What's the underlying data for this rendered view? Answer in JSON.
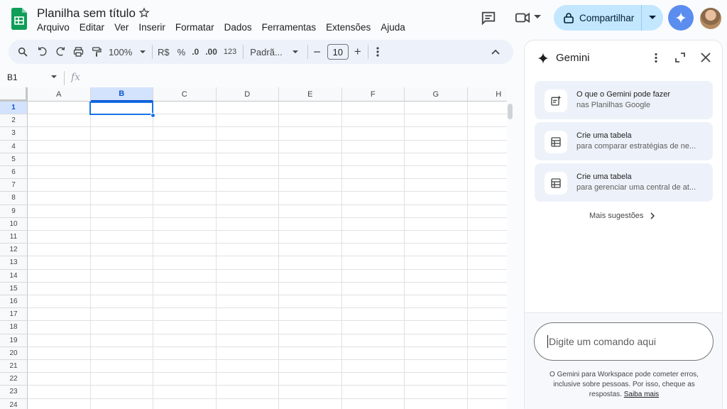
{
  "doc": {
    "title": "Planilha sem título"
  },
  "menu": [
    "Arquivo",
    "Editar",
    "Ver",
    "Inserir",
    "Formatar",
    "Dados",
    "Ferramentas",
    "Extensões",
    "Ajuda"
  ],
  "header": {
    "share_label": "Compartilhar"
  },
  "toolbar": {
    "zoom": "100%",
    "currency": "R$",
    "percent": "%",
    "dec_dec": ".0",
    "dec_inc": ".00",
    "number_format": "123",
    "font": "Padrã...",
    "font_size": "10"
  },
  "namebox": {
    "cell": "B1",
    "fx": "fx"
  },
  "grid": {
    "columns": [
      "A",
      "B",
      "C",
      "D",
      "E",
      "F",
      "G",
      "H"
    ],
    "rows": [
      "1",
      "2",
      "3",
      "4",
      "5",
      "6",
      "7",
      "8",
      "9",
      "10",
      "11",
      "12",
      "13",
      "14",
      "15",
      "16",
      "17",
      "18",
      "19",
      "20",
      "21",
      "22",
      "23",
      "24"
    ],
    "selected_column": "B",
    "selected_row": "1"
  },
  "gemini": {
    "title": "Gemini",
    "suggestions": [
      {
        "title": "O que o Gemini pode fazer",
        "subtitle": "nas Planilhas Google",
        "icon": "sparkle-doc-icon"
      },
      {
        "title": "Crie uma tabela",
        "subtitle": "para comparar estratégias de ne...",
        "icon": "table-icon"
      },
      {
        "title": "Crie uma tabela",
        "subtitle": "para gerenciar uma central de at...",
        "icon": "table-icon"
      }
    ],
    "more_label": "Mais sugestões",
    "prompt_placeholder": "Digite um comando aqui",
    "disclaimer": "O Gemini para Workspace pode cometer erros, inclusive sobre pessoas. Por isso, cheque as respostas.",
    "learn_more": "Saiba mais"
  },
  "colors": {
    "accent": "#1a73e8",
    "share_bg": "#c2e7ff",
    "toolbar_bg": "#edf2fa",
    "sheets_green": "#0f9d58"
  }
}
